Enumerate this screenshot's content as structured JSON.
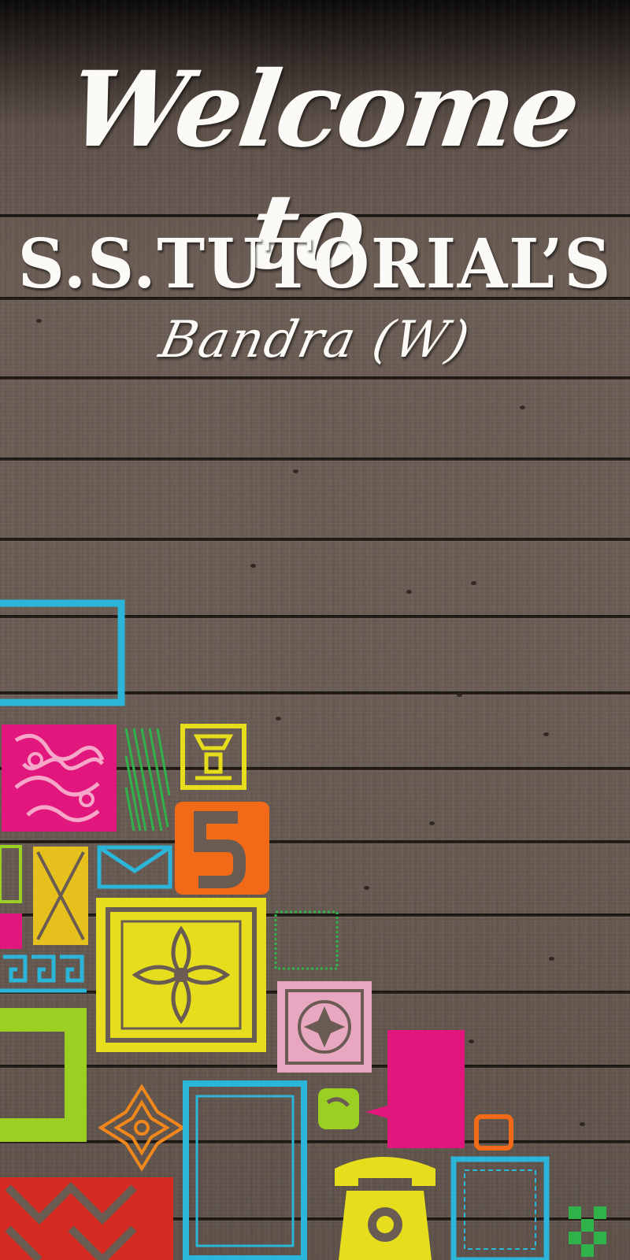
{
  "heading": {
    "welcome": "Welcome to",
    "brand": "S.S.TUTORIAL’S",
    "location": "Bandra (W)"
  },
  "colors": {
    "text": "#fbfaf7",
    "wood": "#6a5c53",
    "cyan": "#2bb5d8",
    "magenta": "#e2177d",
    "yellow": "#e6de1c",
    "lime": "#9bcf24",
    "orange": "#f26a17",
    "pink": "#e7a7c0",
    "red": "#d42a22",
    "green": "#2fb24a"
  },
  "decorations": {
    "icons": [
      "frame-outline-icon",
      "ornate-tile-icon",
      "striped-tile-icon",
      "vase-stencil-icon",
      "number-five-icon",
      "envelope-icon",
      "floral-tile-icon",
      "small-frame-icon",
      "rosette-tile-icon",
      "speech-bubble-icon",
      "star-flower-icon",
      "mirror-frame-icon",
      "telephone-icon",
      "checker-icon"
    ]
  }
}
